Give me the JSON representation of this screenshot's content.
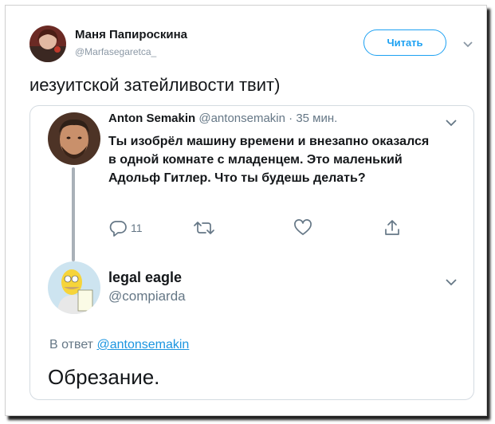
{
  "author": {
    "name": "Маня Папироскина",
    "handle": "@Marfasegaretca_",
    "follow_label": "Читать"
  },
  "tweet": {
    "text": "иезуитской затейливости твит)"
  },
  "quoted": {
    "name": "Anton Semakin",
    "handle": "@antonsemakin",
    "separator": "·",
    "time": "35 мин.",
    "text": "Ты изобрёл машину времени и внезапно оказался в одной комнате с младенцем. Это маленький Адольф Гитлер. Что ты будешь делать?",
    "reply_count": "11"
  },
  "reply": {
    "name": "legal eagle",
    "handle": "@compiarda",
    "reply_prefix": "В ответ",
    "reply_to": "@antonsemakin",
    "text": "Обрезание."
  },
  "icons": [
    "chevron-down-icon",
    "reply-icon",
    "retweet-icon",
    "like-icon",
    "share-icon"
  ],
  "colors": {
    "accent": "#1da1f2",
    "link": "#1b95e0",
    "secondary_text": "#657786",
    "border": "#d4dbe1"
  }
}
